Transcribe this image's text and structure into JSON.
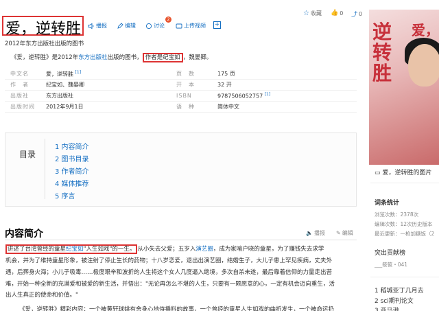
{
  "title": "爱，逆转胜",
  "toolbar": {
    "play": "播报",
    "edit": "编辑",
    "discuss": "讨论",
    "discuss_count": "2",
    "upload": "上传视频",
    "add": "+"
  },
  "top_right": {
    "collect": "收藏",
    "like_count": "0",
    "share_count": "0"
  },
  "subtitle": "2012年东方出版社出版的图书",
  "summary": {
    "prefix": "《爱，逆转胜》是2012年",
    "publisher_link": "东方出版社",
    "mid": "出版的图书，",
    "highlight": "作者是纪宝如",
    "suffix": "，魏晏卿。"
  },
  "info": [
    {
      "k1": "中文名",
      "v1": "爱，逆转胜",
      "sup1": "[1]",
      "k2": "页　数",
      "v2": "175 页",
      "sup2": ""
    },
    {
      "k1": "作　者",
      "v1": "纪宝如、魏晏卿",
      "sup1": "",
      "k2": "开　本",
      "v2": "32 开",
      "sup2": ""
    },
    {
      "k1": "出版社",
      "v1": "东方出版社",
      "sup1": "",
      "k2": "ISBN",
      "v2": "9787506052757",
      "sup2": "[1]"
    },
    {
      "k1": "出版时间",
      "v1": "2012年9月1日",
      "sup1": "",
      "k2": "语　种",
      "v2": "简体中文",
      "sup2": ""
    }
  ],
  "toc": {
    "label": "目录",
    "items": [
      "1  内容简介",
      "2  图书目录",
      "3  作者简介",
      "4  媒体推荐",
      "5  序言"
    ]
  },
  "section": {
    "title": "内容简介",
    "play": "播报",
    "edit": "编辑",
    "p1_highlight_a": "讲述了台湾曾经的童星",
    "p1_highlight_link": "纪宝如",
    "p1_highlight_b": "\"人生如戏\"的一生。",
    "p1_rest": "从小失去父爱；五岁入",
    "p1_link": "演艺圈",
    "p1_rest2": "，成为家喻户晓的童星，为了赚钱失去求学",
    "p2": "机会，并为了维持童星形象，被注射了停止生长的药物；十八岁恋爱，退出出演艺圈，结婚生子，大儿子患上罕见疾病，丈夫外",
    "p3": "遇，后葬身火海；小儿子吸毒……极度艰辛和波折的人生将这个女人几度逼入绝境，多次自杀未遂，最后靠着信仰的力量走出苦",
    "p4": "难，开始一种全新的充满爱和被爱的新生活，并悟出：\"无论再怎么不堪的人生，只要有一颗愿意的心，一定有机会迈向重生，活",
    "p5": "出人生真正的使命和价值。\"",
    "p6": "《爱，逆转胜》精彩内容：一个被黄轩球姚有舍身心地侍播料的故事，一个曾经的童星人生如戏的曲折发生，一个被命运扔"
  },
  "sidebar": {
    "cover_title_a": "逆\n转\n胜",
    "cover_title_b": "爱，",
    "caption": "爱，逆转胜的图片",
    "stats_h": "词条统计",
    "browse": "浏览次数：2378次",
    "edits": "编辑次数：12次历史版本",
    "update": "最近更新：一枪加糖饭（2",
    "contrib_h": "突出贡献榜",
    "contrib": "___筱筱・041",
    "rank1": "1  稻城亚丁几月去",
    "rank2": "2  sci期刊论文",
    "rank3": "3  亚马逊"
  },
  "colors": {
    "link": "#136ec2",
    "highlight_border": "#dd3333"
  }
}
